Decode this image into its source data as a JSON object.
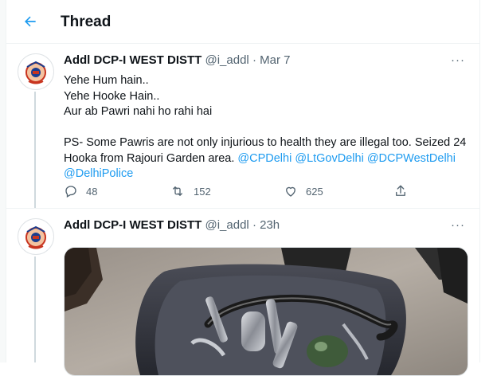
{
  "header": {
    "title": "Thread"
  },
  "icons": {
    "back": "arrow-left-icon",
    "more": "more-horizontal-icon",
    "reply": "reply-icon",
    "retweet": "retweet-icon",
    "like": "heart-icon",
    "share": "share-icon"
  },
  "colors": {
    "accent": "#1d9bf0",
    "text": "#0f1419",
    "muted": "#536471",
    "border": "#eff3f4"
  },
  "tweets": [
    {
      "name": "Addl DCP-I WEST DISTT",
      "handle": "@i_addl",
      "separator": "·",
      "time": "Mar 7",
      "more": "···",
      "lines": [
        "Yehe Hum hain..",
        "Yehe Hooke Hain..",
        "Aur ab Pawri nahi ho rahi hai"
      ],
      "ps_text": "PS- Some Pawris are not only injurious to health they are illegal too.  Seized 24 Hooka from Rajouri Garden area. ",
      "mentions": [
        "@CPDelhi",
        "@LtGovDelhi",
        "@DCPWestDelhi",
        "@DelhiPolice"
      ],
      "stats": {
        "replies": "48",
        "retweets": "152",
        "likes": "625"
      }
    },
    {
      "name": "Addl DCP-I WEST DISTT",
      "handle": "@i_addl",
      "separator": "·",
      "time": "23h",
      "more": "···"
    }
  ]
}
